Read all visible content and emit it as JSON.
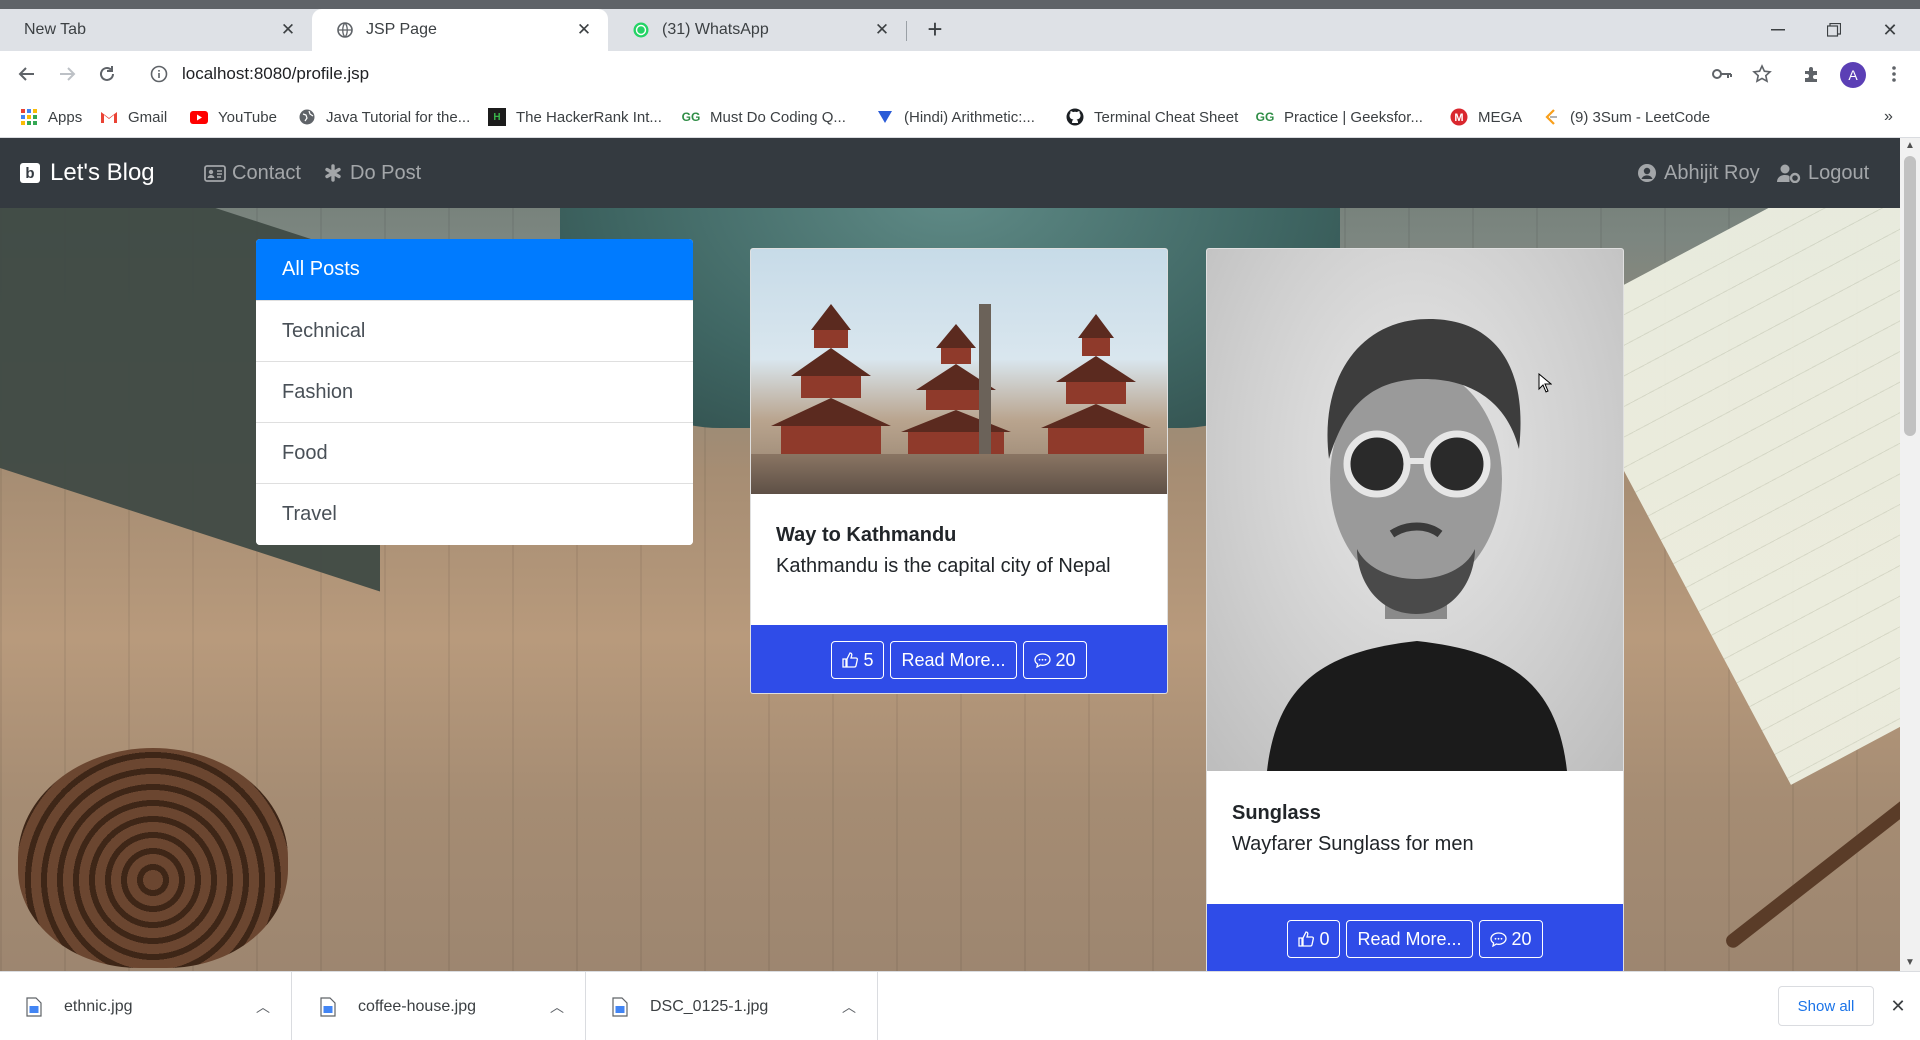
{
  "browser": {
    "tabs": [
      {
        "title": "New Tab"
      },
      {
        "title": "JSP Page"
      },
      {
        "title": "(31) WhatsApp"
      }
    ],
    "url": "localhost:8080/profile.jsp",
    "avatar_letter": "A",
    "bookmarks": [
      {
        "label": "Apps"
      },
      {
        "label": "Gmail"
      },
      {
        "label": "YouTube"
      },
      {
        "label": "Java Tutorial for the..."
      },
      {
        "label": "The HackerRank Int..."
      },
      {
        "label": "Must Do Coding Q..."
      },
      {
        "label": "(Hindi) Arithmetic:..."
      },
      {
        "label": "Terminal Cheat Sheet"
      },
      {
        "label": "Practice | Geeksfor..."
      },
      {
        "label": "MEGA"
      },
      {
        "label": "(9) 3Sum - LeetCode"
      }
    ]
  },
  "navbar": {
    "brand": "Let's Blog",
    "links": [
      {
        "label": "Contact"
      },
      {
        "label": "Do Post"
      }
    ],
    "user": "Abhijit Roy",
    "logout": "Logout"
  },
  "categories": [
    {
      "label": "All Posts"
    },
    {
      "label": "Technical"
    },
    {
      "label": "Fashion"
    },
    {
      "label": "Food"
    },
    {
      "label": "Travel"
    }
  ],
  "posts": [
    {
      "title": "Way to Kathmandu",
      "text": "Kathmandu is the capital city of Nepal",
      "likes": "5",
      "read_more": "Read More...",
      "comments": "20"
    },
    {
      "title": "Sunglass",
      "text": "Wayfarer Sunglass for men",
      "likes": "0",
      "read_more": "Read More...",
      "comments": "20"
    }
  ],
  "downloads": [
    {
      "name": "ethnic.jpg"
    },
    {
      "name": "coffee-house.jpg"
    },
    {
      "name": "DSC_0125-1.jpg"
    }
  ],
  "show_all": "Show all",
  "colors": {
    "navbar": "#343a40",
    "active_category": "#007bff",
    "card_footer": "#2f4ce8",
    "link_blue": "#1a73e8"
  }
}
